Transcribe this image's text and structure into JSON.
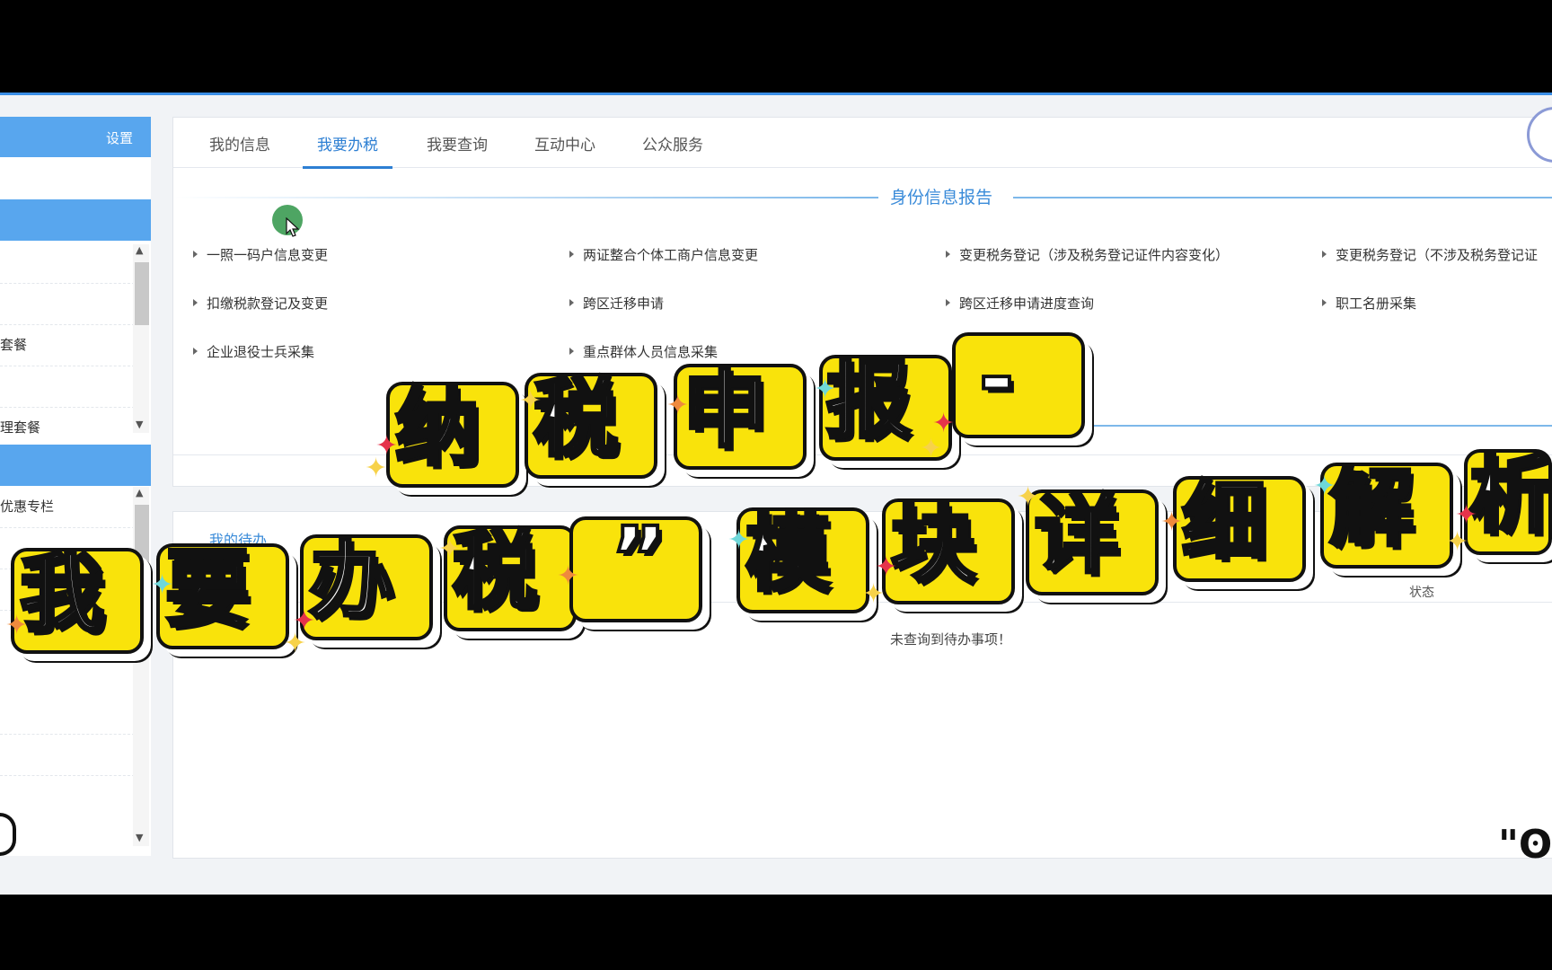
{
  "sidebar": {
    "settings_label": "设置",
    "items": [
      {
        "label": ""
      },
      {
        "label": ""
      },
      {
        "label": "套餐"
      },
      {
        "label": ""
      },
      {
        "label": "理套餐"
      },
      {
        "label": "优惠专栏"
      }
    ]
  },
  "tabs": [
    {
      "label": "我的信息",
      "active": false
    },
    {
      "label": "我要办税",
      "active": true
    },
    {
      "label": "我要查询",
      "active": false
    },
    {
      "label": "互动中心",
      "active": false
    },
    {
      "label": "公众服务",
      "active": false
    }
  ],
  "section": {
    "title": "身份信息报告",
    "links": [
      [
        "一照一码户信息变更",
        "两证整合个体工商户信息变更",
        "变更税务登记（涉及税务登记证件内容变化）",
        "变更税务登记（不涉及税务登记证"
      ],
      [
        "扣缴税款登记及变更",
        "跨区迁移申请",
        "跨区迁移申请进度查询",
        "职工名册采集"
      ],
      [
        "企业退役士兵采集",
        "重点群体人员信息采集"
      ]
    ]
  },
  "lower": {
    "title": "我的待办",
    "status_header": "状态",
    "empty_text": "未查询到待办事项！"
  },
  "overlay": {
    "line1": [
      "纳",
      "税",
      "申",
      "报",
      "-"
    ],
    "line2": [
      "我",
      "要",
      "办",
      "税",
      "”",
      "模",
      "块",
      "详",
      "细",
      "解",
      "析"
    ],
    "spark_colors": [
      "#f7d24a",
      "#ef8a3d",
      "#e5334b",
      "#6ed7d9"
    ]
  }
}
